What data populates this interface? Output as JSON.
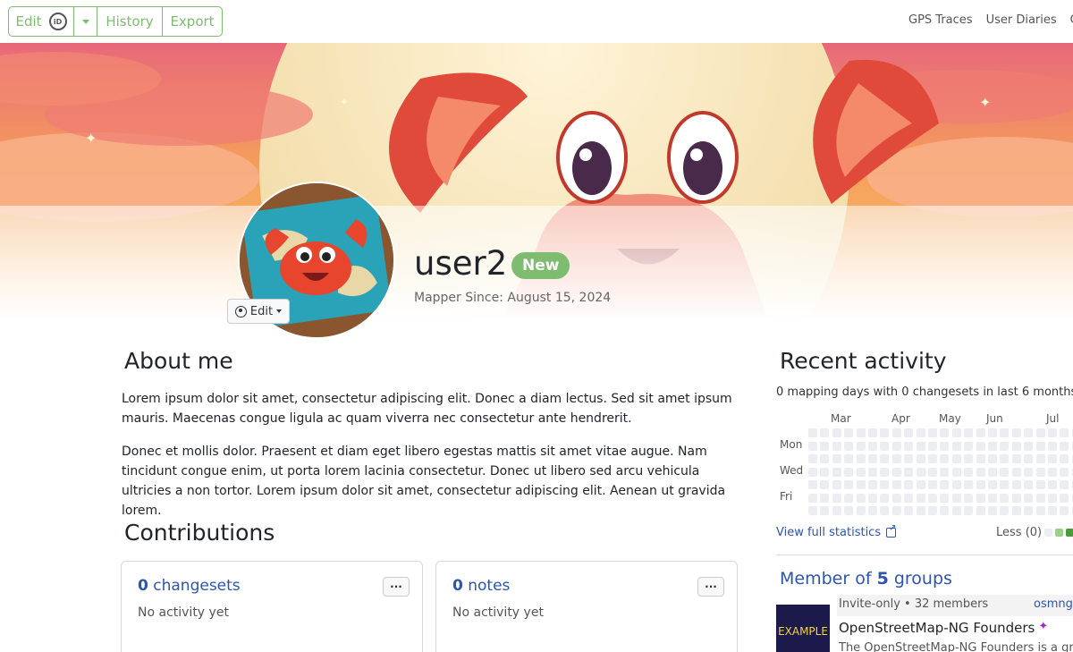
{
  "toolbar": {
    "edit_label": "Edit",
    "id_icon_text": "iD",
    "history_label": "History",
    "export_label": "Export",
    "accent_color": "#7ebc6f"
  },
  "nav": {
    "items": [
      "GPS Traces",
      "User Diaries",
      "Co"
    ]
  },
  "profile": {
    "username": "user2",
    "badge": "New",
    "mapper_since": "Mapper Since: August 15, 2024",
    "avatar_edit_label": "Edit"
  },
  "about": {
    "heading": "About me",
    "paragraphs": [
      "Lorem ipsum dolor sit amet, consectetur adipiscing elit. Donec a diam lectus. Sed sit amet ipsum mauris. Maecenas congue ligula ac quam viverra nec consectetur ante hendrerit.",
      "Donec et mollis dolor. Praesent et diam eget libero egestas mattis sit amet vitae augue. Nam tincidunt congue enim, ut porta lorem lacinia consectetur. Donec ut libero sed arcu vehicula ultricies a non tortor. Lorem ipsum dolor sit amet, consectetur adipiscing elit. Aenean ut gravida lorem."
    ]
  },
  "contributions": {
    "heading": "Contributions",
    "cards": [
      {
        "count": "0",
        "label": "changesets",
        "status": "No activity yet",
        "menu": "···"
      },
      {
        "count": "0",
        "label": "notes",
        "status": "No activity yet",
        "menu": "···"
      }
    ]
  },
  "activity": {
    "heading": "Recent activity",
    "summary": "0 mapping days with 0 changesets in last 6 months",
    "months": [
      "Mar",
      "Apr",
      "May",
      "Jun",
      "Jul"
    ],
    "days": [
      "Mon",
      "Wed",
      "Fri"
    ],
    "view_stats": "View full statistics",
    "legend_less": "Less (0)",
    "legend_colors": [
      "#ebedf0",
      "#9bd08b",
      "#7ebc6f",
      "#4a9a3a"
    ]
  },
  "groups": {
    "heading_prefix": "Member of",
    "count": "5",
    "heading_suffix": "groups",
    "items": [
      {
        "thumb_text": "EXAMPLE",
        "meta": "Invite-only • 32 members",
        "tag": "osmng",
        "name": "OpenStreetMap-NG Founders",
        "desc": "The OpenStreetMap-NG Founders is a group"
      }
    ]
  }
}
